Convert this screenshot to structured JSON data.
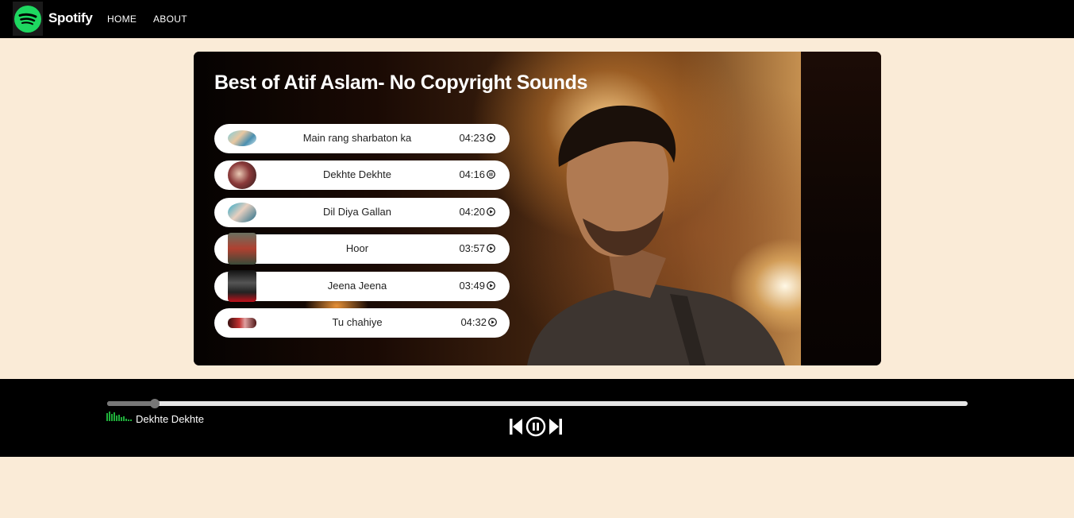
{
  "nav": {
    "brand": "Spotify",
    "links": [
      "HOME",
      "ABOUT"
    ]
  },
  "playlist": {
    "title": "Best of Atif Aslam- No Copyright Sounds",
    "songs": [
      {
        "name": "Main rang sharbaton ka",
        "duration": "04:23",
        "state": "play"
      },
      {
        "name": "Dekhte Dekhte",
        "duration": "04:16",
        "state": "pause"
      },
      {
        "name": "Dil Diya Gallan",
        "duration": "04:20",
        "state": "play"
      },
      {
        "name": "Hoor",
        "duration": "03:57",
        "state": "play"
      },
      {
        "name": "Jeena Jeena",
        "duration": "03:49",
        "state": "play"
      },
      {
        "name": "Tu chahiye",
        "duration": "04:32",
        "state": "play"
      }
    ]
  },
  "player": {
    "now_playing": "Dekhte Dekhte",
    "progress": 0.055,
    "state": "playing"
  },
  "colors": {
    "page_bg": "#faebd7",
    "bar_bg": "#000000",
    "brand_green": "#1ed760"
  }
}
